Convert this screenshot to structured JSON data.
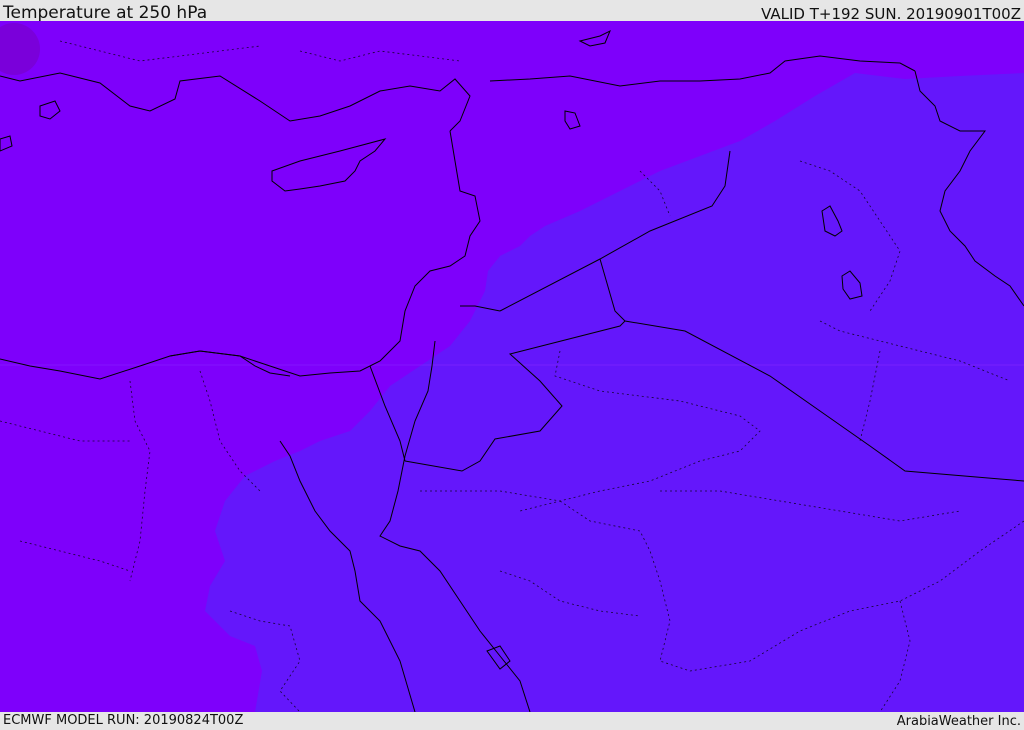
{
  "header": {
    "title": "Temperature at 250 hPa",
    "valid": "VALID T+192 SUN. 20190901T00Z"
  },
  "footer": {
    "model_run": "ECMWF MODEL RUN: 20190824T00Z",
    "credit": "ArabiaWeather Inc."
  },
  "colors": {
    "cold_band": "#7e00fb",
    "warmer_band": "#6417fb",
    "cold_core": "#73009e",
    "coastline": "#000000",
    "background": "#e6e6e6"
  }
}
